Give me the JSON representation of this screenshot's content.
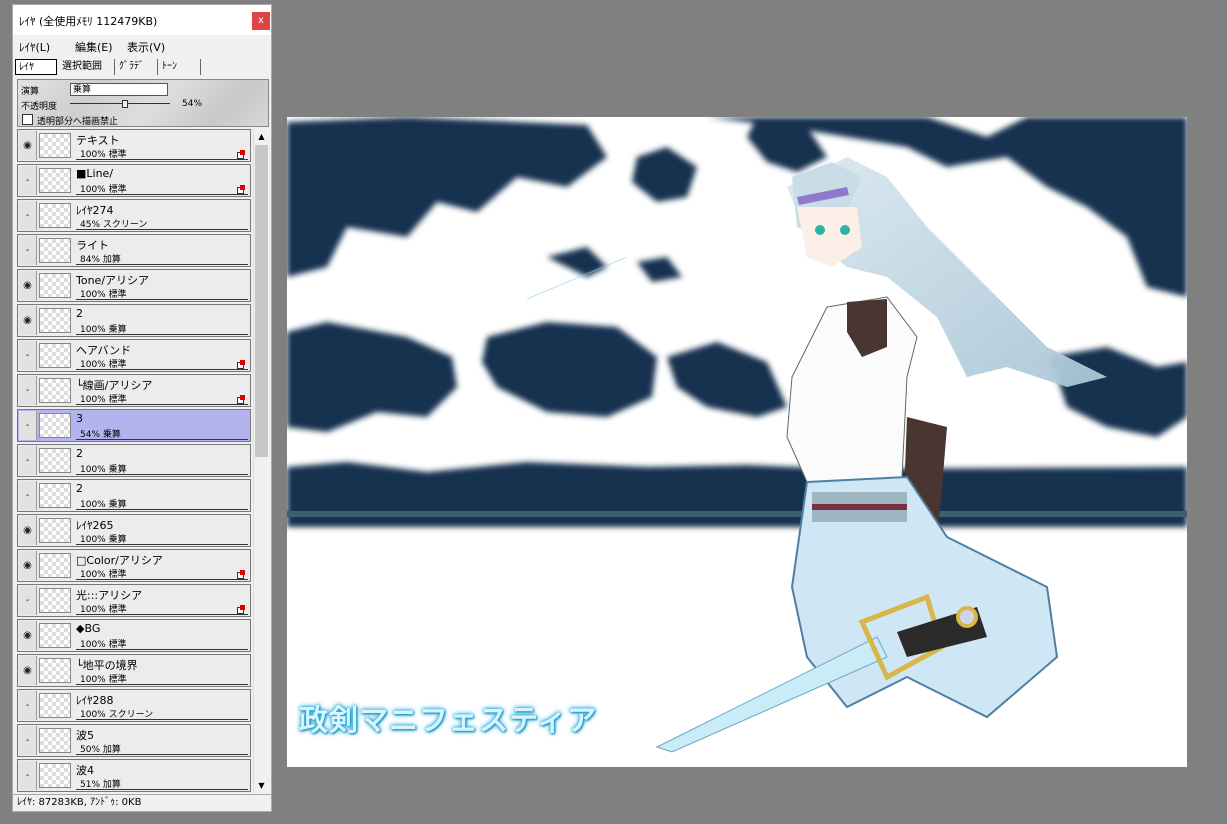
{
  "panel": {
    "title": "ﾚｲﾔ (全使用ﾒﾓﾘ 112479KB)",
    "close_label": "x",
    "menu": [
      "ﾚｲﾔ(L)",
      "編集(E)",
      "表示(V)"
    ],
    "tabs": [
      "ﾚｲﾔ",
      "選択範囲",
      "ｸﾞﾗﾃﾞ",
      "ﾄｰﾝ"
    ],
    "blend_label": "演算",
    "blend_value": "乗算",
    "opacity_label": "不透明度",
    "opacity_value": "54%",
    "opacity_fraction": 0.54,
    "protect_label": "透明部分へ描画禁止",
    "protect_checked": false,
    "status": "ﾚｲﾔ: 87283KB, ｱﾝﾄﾞｩ: 0KB",
    "scroll_up": "▲",
    "scroll_down": "▼"
  },
  "layers": [
    {
      "name": "テキスト",
      "info": "100% 標準",
      "visible": true,
      "mark": true,
      "selected": false
    },
    {
      "name": "■Line/",
      "info": "100% 標準",
      "visible": false,
      "mark": true,
      "selected": false
    },
    {
      "name": "ﾚｲﾔ274",
      "info": "45% スクリーン",
      "visible": false,
      "mark": false,
      "selected": false
    },
    {
      "name": "ライト",
      "info": "84% 加算",
      "visible": false,
      "mark": false,
      "selected": false
    },
    {
      "name": "Tone/アリシア",
      "info": "100% 標準",
      "visible": true,
      "mark": false,
      "selected": false
    },
    {
      "name": "2",
      "info": "100% 乗算",
      "visible": true,
      "mark": false,
      "selected": false
    },
    {
      "name": "ヘアバンド",
      "info": "100% 標準",
      "visible": false,
      "mark": true,
      "selected": false
    },
    {
      "name": "└線画/アリシア",
      "info": "100% 標準",
      "visible": false,
      "mark": true,
      "selected": false
    },
    {
      "name": "3",
      "info": "54% 乗算",
      "visible": false,
      "mark": false,
      "selected": true
    },
    {
      "name": "2",
      "info": "100% 乗算",
      "visible": false,
      "mark": false,
      "selected": false
    },
    {
      "name": "2",
      "info": "100% 乗算",
      "visible": false,
      "mark": false,
      "selected": false
    },
    {
      "name": "ﾚｲﾔ265",
      "info": "100% 乗算",
      "visible": true,
      "mark": false,
      "selected": false
    },
    {
      "name": "□Color/アリシア",
      "info": "100% 標準",
      "visible": true,
      "mark": true,
      "selected": false
    },
    {
      "name": "光:::アリシア",
      "info": "100% 標準",
      "visible": false,
      "mark": true,
      "selected": false
    },
    {
      "name": "◆BG",
      "info": "100% 標準",
      "visible": true,
      "mark": false,
      "selected": false
    },
    {
      "name": "└地平の境界",
      "info": "100% 標準",
      "visible": true,
      "mark": false,
      "selected": false
    },
    {
      "name": "ﾚｲﾔ288",
      "info": "100% スクリーン",
      "visible": false,
      "mark": false,
      "selected": false
    },
    {
      "name": "波5",
      "info": "50% 加算",
      "visible": false,
      "mark": false,
      "selected": false
    },
    {
      "name": "波4",
      "info": "51% 加算",
      "visible": false,
      "mark": false,
      "selected": false
    }
  ],
  "canvas": {
    "title_text": "政剣マニフェスティア",
    "colors": {
      "cloud": "#12304f",
      "hair": "#c9dde6",
      "sky_bottom": "#ffffff",
      "title_glow": "#1aa7d8"
    }
  },
  "colors": {
    "selected_row": "#b3b3ee",
    "close_button": "#e04343",
    "background": "#808080"
  }
}
